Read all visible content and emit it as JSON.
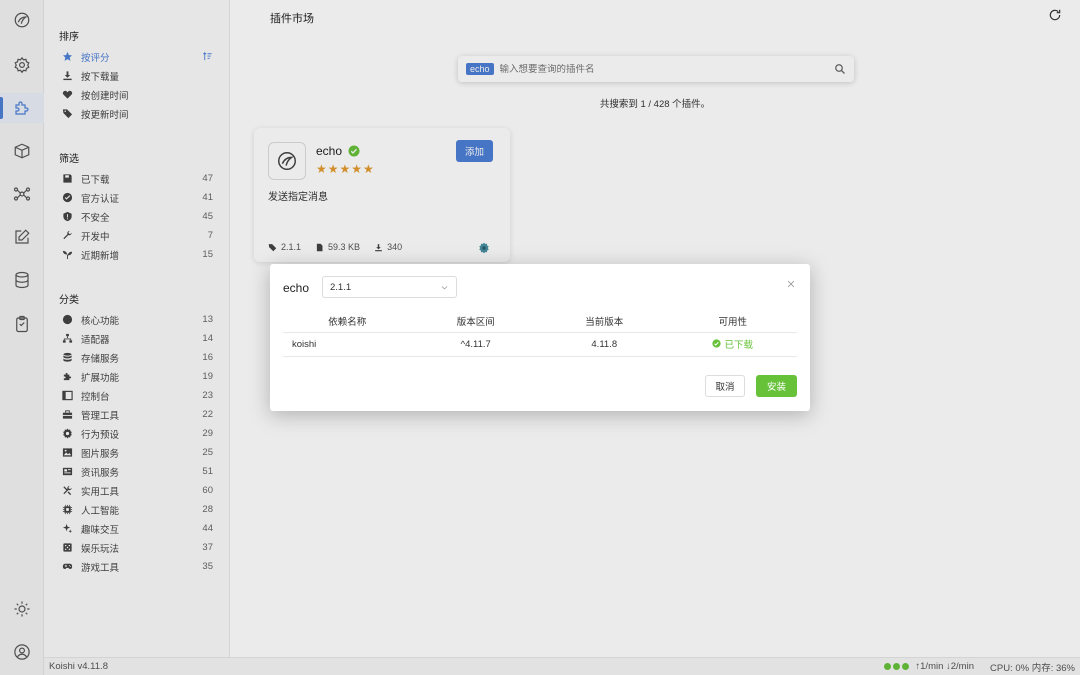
{
  "app": {
    "version_label": "Koishi v4.11.8"
  },
  "rail": {
    "items": [
      "koishi-logo-icon",
      "gear-icon",
      "puzzle-icon",
      "box-icon",
      "network-icon",
      "edit-icon",
      "database-icon",
      "clipboard-icon"
    ],
    "bottom": [
      "sun-icon",
      "user-icon"
    ]
  },
  "sidebar": {
    "sort": {
      "title": "排序",
      "items": [
        {
          "label": "按评分",
          "icon": "star-icon"
        },
        {
          "label": "按下载量",
          "icon": "download-icon"
        },
        {
          "label": "按创建时间",
          "icon": "heart-pulse-icon"
        },
        {
          "label": "按更新时间",
          "icon": "tag-icon"
        }
      ]
    },
    "filter": {
      "title": "筛选",
      "items": [
        {
          "label": "已下载",
          "count": "47",
          "icon": "save-icon"
        },
        {
          "label": "官方认证",
          "count": "41",
          "icon": "badge-check-icon"
        },
        {
          "label": "不安全",
          "count": "45",
          "icon": "shield-alert-icon"
        },
        {
          "label": "开发中",
          "count": "7",
          "icon": "wrench-icon"
        },
        {
          "label": "近期新增",
          "count": "15",
          "icon": "seedling-icon"
        }
      ]
    },
    "category": {
      "title": "分类",
      "items": [
        {
          "label": "核心功能",
          "count": "13",
          "icon": "circle-icon"
        },
        {
          "label": "适配器",
          "count": "14",
          "icon": "sitemap-icon"
        },
        {
          "label": "存储服务",
          "count": "16",
          "icon": "database-icon"
        },
        {
          "label": "扩展功能",
          "count": "19",
          "icon": "puzzle-icon"
        },
        {
          "label": "控制台",
          "count": "23",
          "icon": "window-icon"
        },
        {
          "label": "管理工具",
          "count": "22",
          "icon": "toolbox-icon"
        },
        {
          "label": "行为预设",
          "count": "29",
          "icon": "cog-icon"
        },
        {
          "label": "图片服务",
          "count": "25",
          "icon": "image-icon"
        },
        {
          "label": "资讯服务",
          "count": "51",
          "icon": "newspaper-icon"
        },
        {
          "label": "实用工具",
          "count": "60",
          "icon": "tools-icon"
        },
        {
          "label": "人工智能",
          "count": "28",
          "icon": "chip-icon"
        },
        {
          "label": "趣味交互",
          "count": "44",
          "icon": "sparkle-icon"
        },
        {
          "label": "娱乐玩法",
          "count": "37",
          "icon": "dice-icon"
        },
        {
          "label": "游戏工具",
          "count": "35",
          "icon": "gamepad-icon"
        }
      ]
    }
  },
  "main": {
    "title": "插件市场",
    "search": {
      "tag": "echo",
      "placeholder": "输入想要查询的插件名"
    },
    "result_text": "共搜索到 1 / 428 个插件。",
    "card": {
      "name": "echo",
      "rating": 5,
      "add_label": "添加",
      "description": "发送指定消息",
      "version": "2.1.1",
      "size": "59.3 KB",
      "downloads": "340"
    }
  },
  "dialog": {
    "title": "echo",
    "version_select": "2.1.1",
    "columns": [
      "依赖名称",
      "版本区间",
      "当前版本",
      "可用性"
    ],
    "rows": [
      {
        "name": "koishi",
        "range": "^4.11.7",
        "current": "4.11.8",
        "status": "已下载"
      }
    ],
    "cancel_label": "取消",
    "install_label": "安装"
  },
  "status": {
    "rate": "↑1/min ↓2/min",
    "cpu": "CPU: 0% 内存: 36%"
  },
  "colors": {
    "accent": "#4e7fd7",
    "success": "#67c23a",
    "star": "#e39b2f"
  }
}
